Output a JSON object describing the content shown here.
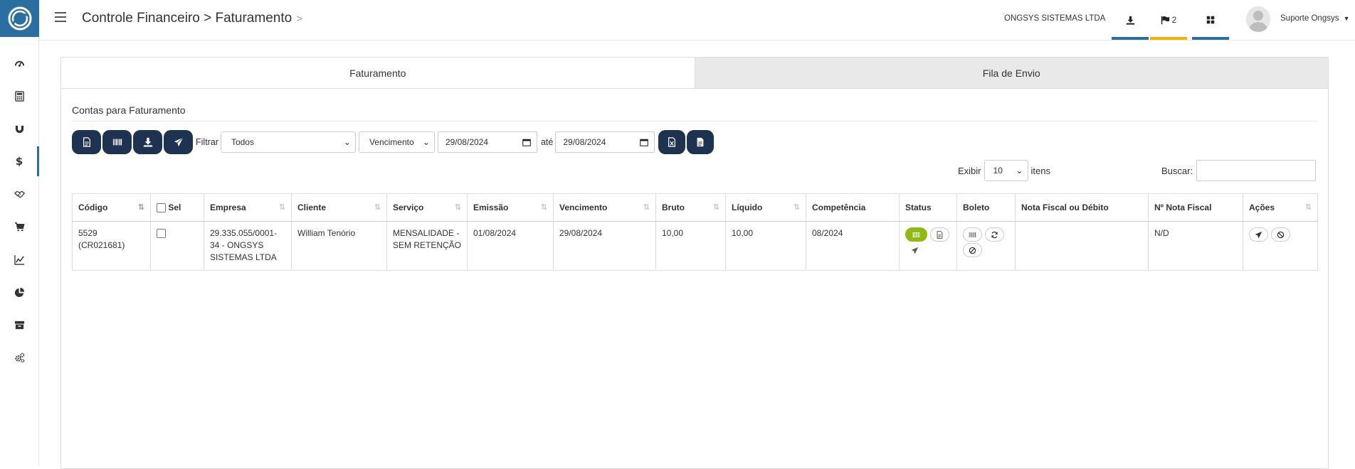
{
  "header": {
    "breadcrumb": "Controle Financeiro > Faturamento",
    "company": "ONGSYS SISTEMAS LTDA",
    "notifications_count": "2",
    "user": "Suporte Ongsys"
  },
  "tabs": [
    {
      "label": "Faturamento",
      "active": true
    },
    {
      "label": "Fila de Envio",
      "active": false
    }
  ],
  "section_title": "Contas para Faturamento",
  "filter": {
    "label": "Filtrar",
    "type_value": "Todos",
    "date_field_value": "Vencimento",
    "date_from": "29/08/2024",
    "ate_label": "até",
    "date_to": "29/08/2024"
  },
  "paging": {
    "exibir_label": "Exibir",
    "page_size": "10",
    "itens_label": "itens",
    "search_label": "Buscar:"
  },
  "table": {
    "headers": [
      "Código",
      "Sel",
      "Empresa",
      "Cliente",
      "Serviço",
      "Emissão",
      "Vencimento",
      "Bruto",
      "Líquido",
      "Competência",
      "Status",
      "Boleto",
      "Nota Fiscal ou Débito",
      "Nº Nota Fiscal",
      "Ações"
    ],
    "rows": [
      {
        "codigo": "5529 (CR021681)",
        "empresa": "29.335.055/0001-34 - ONGSYS SISTEMAS LTDA",
        "cliente": "William Tenório",
        "servico": "MENSALIDADE - SEM RETENÇÃO",
        "emissao": "01/08/2024",
        "vencimento": "29/08/2024",
        "bruto": "10,00",
        "liquido": "10,00",
        "competencia": "08/2024",
        "nota_fiscal": "",
        "num_nota_fiscal": "N/D"
      }
    ]
  },
  "colors": {
    "brand": "#2b6fa0",
    "button_dark": "#1e3352",
    "status_green": "#8fb915",
    "bar_download": "#2b6fa0",
    "bar_flags": "#f5b301",
    "bar_apps": "#2b6fa0"
  },
  "icons": {
    "sidebar": [
      "dashboard-icon",
      "calculator-icon",
      "magnet-icon",
      "dollar-icon",
      "handshake-icon",
      "cart-icon",
      "line-chart-icon",
      "pie-chart-icon",
      "archive-icon",
      "cogs-icon"
    ]
  }
}
